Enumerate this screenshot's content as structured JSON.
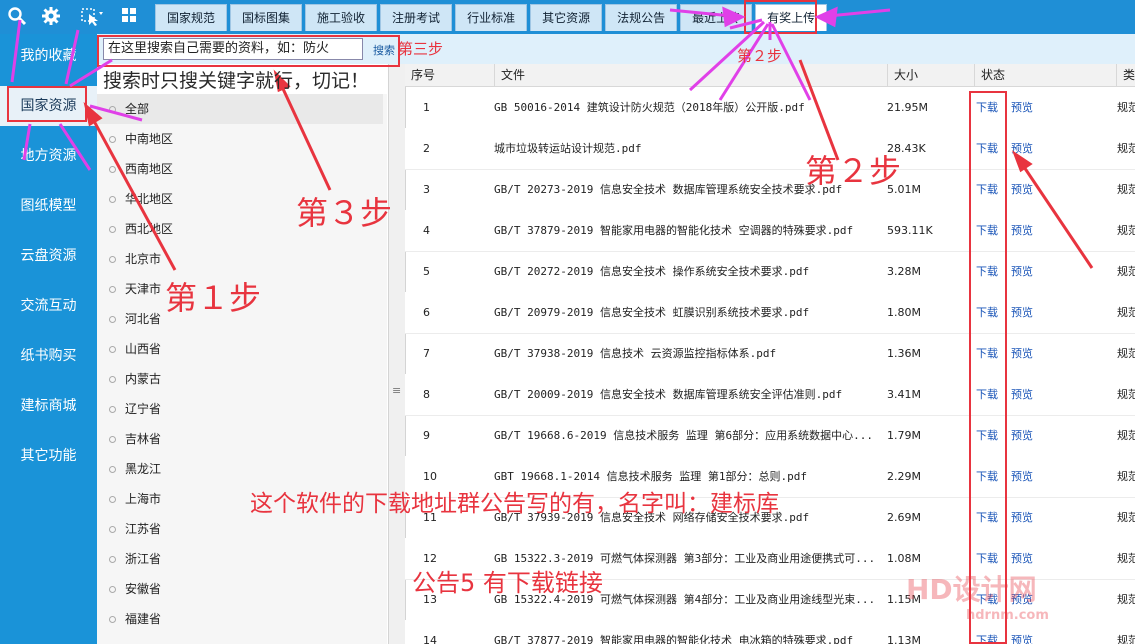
{
  "toolbar": {
    "icons": [
      "search-icon",
      "gear-icon",
      "cursor-menu-icon",
      "grid-icon"
    ]
  },
  "tabs": [
    {
      "label": "国家规范"
    },
    {
      "label": "国标图集"
    },
    {
      "label": "施工验收"
    },
    {
      "label": "注册考试"
    },
    {
      "label": "行业标准"
    },
    {
      "label": "其它资源"
    },
    {
      "label": "法规公告"
    },
    {
      "label": "最近上传"
    },
    {
      "label": "有奖上传"
    }
  ],
  "sidebar": {
    "items": [
      {
        "label": "我的收藏"
      },
      {
        "label": "国家资源"
      },
      {
        "label": "地方资源"
      },
      {
        "label": "图纸模型"
      },
      {
        "label": "云盘资源"
      },
      {
        "label": "交流互动"
      },
      {
        "label": "纸书购买"
      },
      {
        "label": "建标商城"
      },
      {
        "label": "其它功能"
      }
    ]
  },
  "search": {
    "value": "在这里搜索自己需要的资料，如：防火",
    "button_label": "搜索"
  },
  "tree": {
    "items": [
      "全部",
      "中南地区",
      "西南地区",
      "华北地区",
      "西北地区",
      "北京市",
      "天津市",
      "河北省",
      "山西省",
      "内蒙古",
      "辽宁省",
      "吉林省",
      "黑龙江",
      "上海市",
      "江苏省",
      "浙江省",
      "安徽省",
      "福建省"
    ]
  },
  "table": {
    "headers": [
      "序号",
      "文件",
      "大小",
      "状态",
      "类"
    ],
    "download_label": "下载",
    "preview_label": "预览",
    "rows": [
      {
        "no": "1",
        "file": "GB 50016-2014 建筑设计防火规范（2018年版）公开版.pdf",
        "size": "21.95M",
        "type": "规范"
      },
      {
        "no": "2",
        "file": "城市垃圾转运站设计规范.pdf",
        "size": "28.43K",
        "type": "规范"
      },
      {
        "no": "3",
        "file": "GB/T 20273-2019 信息安全技术 数据库管理系统安全技术要求.pdf",
        "size": "5.01M",
        "type": "规范"
      },
      {
        "no": "4",
        "file": "GB/T 37879-2019 智能家用电器的智能化技术 空调器的特殊要求.pdf",
        "size": "593.11K",
        "type": "规范"
      },
      {
        "no": "5",
        "file": "GB/T 20272-2019 信息安全技术 操作系统安全技术要求.pdf",
        "size": "3.28M",
        "type": "规范"
      },
      {
        "no": "6",
        "file": "GB/T 20979-2019 信息安全技术 虹膜识别系统技术要求.pdf",
        "size": "1.80M",
        "type": "规范"
      },
      {
        "no": "7",
        "file": "GB/T 37938-2019 信息技术 云资源监控指标体系.pdf",
        "size": "1.36M",
        "type": "规范"
      },
      {
        "no": "8",
        "file": "GB/T 20009-2019 信息安全技术 数据库管理系统安全评估准则.pdf",
        "size": "3.41M",
        "type": "规范"
      },
      {
        "no": "9",
        "file": "GB/T 19668.6-2019 信息技术服务 监理 第6部分：应用系统数据中心...",
        "size": "1.79M",
        "type": "规范"
      },
      {
        "no": "10",
        "file": "GBT 19668.1-2014 信息技术服务 监理 第1部分：总则.pdf",
        "size": "2.29M",
        "type": "规范"
      },
      {
        "no": "11",
        "file": "GB/T 37939-2019 信息安全技术 网络存储安全技术要求.pdf",
        "size": "2.69M",
        "type": "规范"
      },
      {
        "no": "12",
        "file": "GB 15322.3-2019 可燃气体探测器 第3部分：工业及商业用途便携式可...",
        "size": "1.08M",
        "type": "规范"
      },
      {
        "no": "13",
        "file": "GB 15322.4-2019 可燃气体探测器 第4部分：工业及商业用途线型光束...",
        "size": "1.15M",
        "type": "规范"
      },
      {
        "no": "14",
        "file": "GB/T 37877-2019 智能家用电器的智能化技术 电冰箱的特殊要求.pdf",
        "size": "1.13M",
        "type": "规范"
      }
    ]
  },
  "annotations": {
    "step3_small": "第三步",
    "search_tip": "搜索时只搜关键字就行，切记！",
    "step3_big": "第３步",
    "step1": "第１步",
    "step2": "第２步",
    "step2_small": "第２步",
    "notice": "这个软件的下载地址群公告写的有，名字叫：建标库",
    "notice2": "公告5 有下载链接",
    "color": "#e8343f"
  },
  "watermark": {
    "brand": "HD设计网",
    "url": "hdrnm.com"
  }
}
